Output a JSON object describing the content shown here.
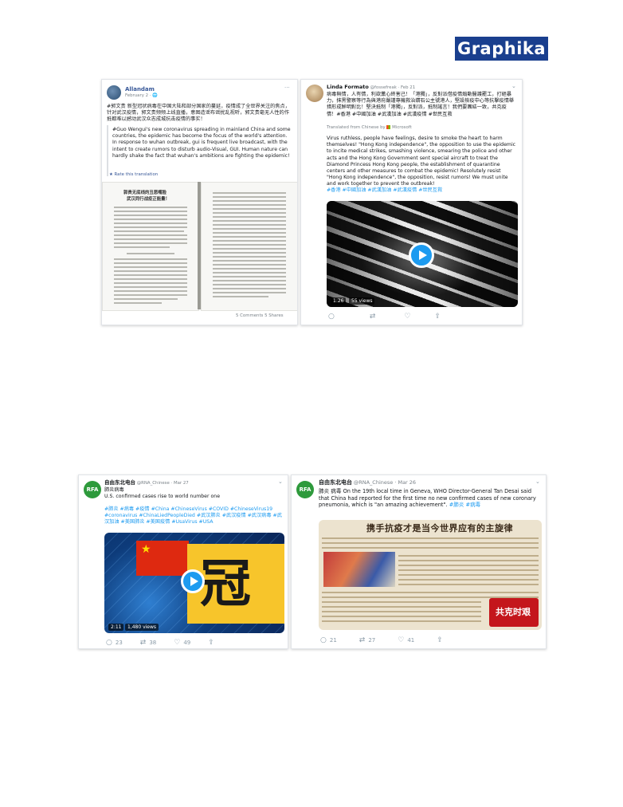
{
  "logo": {
    "text": "Graphika"
  },
  "post1": {
    "author": "Allandam",
    "date": "February 2 · ",
    "body_zh": "#郭文贵 新型冠状病毒在中国大陆和部分国家的蔓延，疫情成了全世界关注的焦点，针对武汉疫情，郭文贵频频上线直播，意图造谣布谣扰乱视听，郭文贵毫无人性的作抵都难以撼动武汉众志成城抗击疫情的事实！",
    "body_en": "#Guo Wengui's new coronavirus spreading in mainland China and some countries, the epidemic has become the focus of the world's attention. In response to wuhan outbreak, gui is frequent live broadcast, with the intent to create rumors to disturb audio-Visual, GUI. Human nature can hardly shake the fact that wuhan's ambitions are fighting the epidemic!",
    "rate": "Rate this translation",
    "doc_title_1": "郭贵无底线的丑恶嘴脸",
    "doc_title_2": "武汉同行战疫正能量！",
    "stats": "5 Comments  5 Shares"
  },
  "post2": {
    "author": "Linda Formato",
    "handle": "@fossefreak · Feb 21",
    "body_zh": "病毒無情，人有情，利欲薰心終害己！「港獨」，反對派借疫情煽動醫護罷工，打砸暴力，抹黑警察等行為與港府嚴謹專機救治鑽石公主號港人，堅設檢疫中心等抗擊疫情舉措形成鮮明對比！堅決抵制「港獨」，反對派，抵制謠言！我們要團結一致，共克疫情！#香港 #中國加油 #武漢加油 #武漢疫情 #世民互救",
    "translated": "Translated from Chinese by",
    "ms": "Microsoft",
    "body_en": "Virus ruthless, people have feelings, desire to smoke the heart to harm themselves! \"Hong Kong independence\", the opposition to use the epidemic to incite medical strikes, smashing violence, smearing the police and other acts and the Hong Kong Government sent special aircraft to treat the Diamond Princess Hong Kong people, the establishment of quarantine centers and other measures to combat the epidemic! Resolutely resist \"Hong Kong independence\", the opposition, resist rumors! We must unite and work together to prevent the outbreak!",
    "hashtags": "#香港 #中國加油 #武漢加油 #武漢疫情 #世民互救",
    "video_time": "1:26",
    "video_views": "55 views"
  },
  "post3": {
    "avatar": "RFA",
    "author": "自由东北电台",
    "handle": "@RNA_Chinese · Mar 27",
    "line1": "肺炎病毒",
    "line2": "U.S. confirmed cases rise to world number one",
    "hashtags": "#肺炎 #病毒 #疫情 #China #ChineseVirus #COVID #ChineseVirus19 #coronavirus #ChinaLiedPeopleDied #武汉肺炎 #武汉疫情 #武汉病毒 #武汉加油 #美国肺炎 #美国疫情 #UsaVirus #USA",
    "video_chars": "冠",
    "video_time": "2:11",
    "video_views": "1,480 views",
    "replies": "23",
    "retweets": "38",
    "likes": "49"
  },
  "post4": {
    "avatar": "RFA",
    "author": "自由东北电台",
    "handle": "@RNA_Chinese · Mar 26",
    "body": "肺炎 病毒 On the 19th local time in Geneva, WHO Director-General Tan Desai said that China had reported for the first time no new confirmed cases of new coronary pneumonia, which is \"an amazing achievement\".",
    "hashtags": "#肺炎 #病毒",
    "headline": "携手抗疫才是当今世界应有的主旋律",
    "inset_text": "共克时艰",
    "replies": "21",
    "retweets": "27",
    "likes": "41"
  },
  "colors": {
    "twitter_blue": "#1d9bf0",
    "logo_bg": "#1a3f8e",
    "flag_red": "#de2910"
  }
}
